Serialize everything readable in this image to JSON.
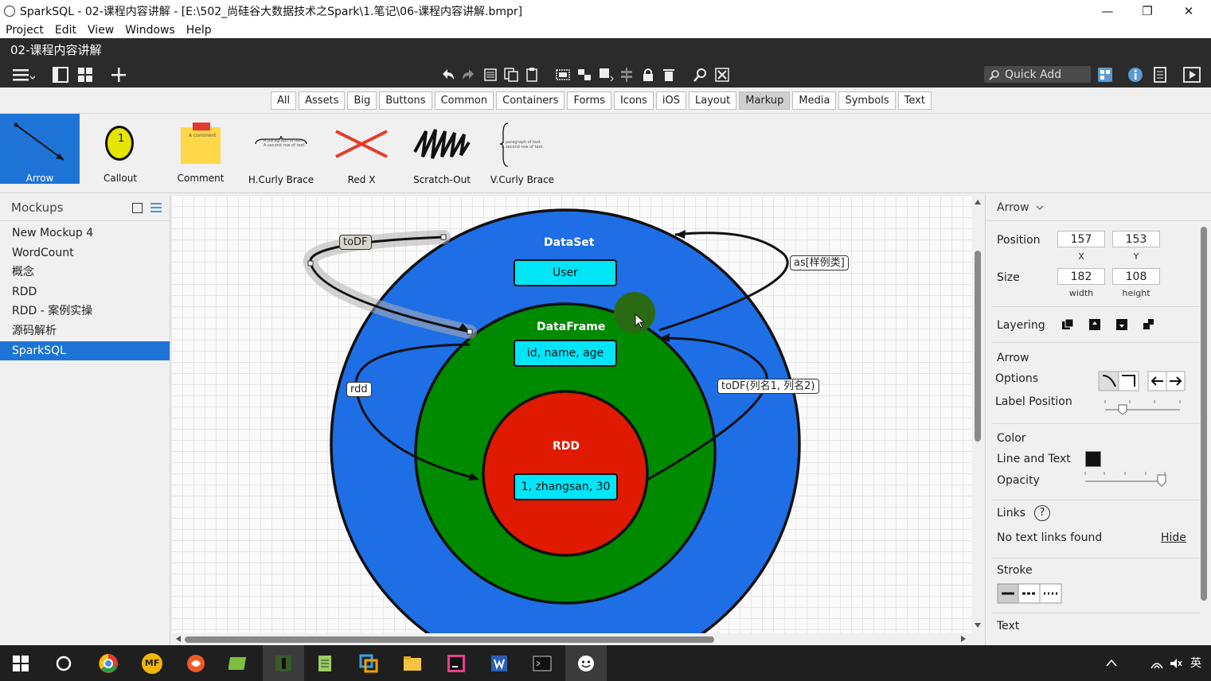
{
  "window": {
    "title": "SparkSQL - 02-课程内容讲解 - [E:\\502_尚硅谷大数据技术之Spark\\1.笔记\\06-课程内容讲解.bmpr]",
    "minimize": "—",
    "maximize": "❐",
    "close": "✕"
  },
  "menu": [
    "Project",
    "Edit",
    "View",
    "Windows",
    "Help"
  ],
  "document": {
    "name": "02-课程内容讲解"
  },
  "toolbar": {
    "quick_add_placeholder": "Quick Add"
  },
  "filters": {
    "tabs": [
      "All",
      "Assets",
      "Big",
      "Buttons",
      "Common",
      "Containers",
      "Forms",
      "Icons",
      "iOS",
      "Layout",
      "Markup",
      "Media",
      "Symbols",
      "Text"
    ],
    "active": "Markup"
  },
  "library": {
    "items": [
      "Arrow",
      "Callout",
      "Comment",
      "H.Curly Brace",
      "Red X",
      "Scratch-Out",
      "V.Curly Brace"
    ],
    "selected": "Arrow",
    "callout_number": "1",
    "comment_text": "A comment",
    "curly_text_1": "A paragraph of text.",
    "curly_text_2": "A second row of text."
  },
  "mockups": {
    "title": "Mockups",
    "items": [
      "New Mockup 4",
      "WordCount",
      "概念",
      "RDD",
      "RDD - 案例实操",
      "源码解析",
      "SparkSQL"
    ],
    "active": "SparkSQL"
  },
  "diagram": {
    "dataset_title": "DataSet",
    "dataset_box": "User",
    "dataframe_title": "DataFrame",
    "dataframe_box": "id, name, age",
    "rdd_title": "RDD",
    "rdd_box": "1, zhangsan, 30",
    "arrow_todf_top": "toDF",
    "arrow_as": "as[样例类]",
    "arrow_rdd": "rdd",
    "arrow_todf_cols": "toDF(列名1, 列名2)",
    "colors": {
      "dataset": "#1e6ee6",
      "dataframe": "#008a00",
      "rdd": "#e01a00",
      "box": "#00e5f8"
    }
  },
  "properties": {
    "header": "Arrow",
    "position_label": "Position",
    "x": "157",
    "y": "153",
    "x_label": "X",
    "y_label": "Y",
    "size_label": "Size",
    "width": "182",
    "height": "108",
    "width_label": "width",
    "height_label": "height",
    "layering_label": "Layering",
    "arrow_label": "Arrow",
    "options_label": "Options",
    "label_position_label": "Label Position",
    "color_label": "Color",
    "line_text_label": "Line and Text",
    "opacity_label": "Opacity",
    "links_label": "Links",
    "links_help": "?",
    "no_links": "No text links found",
    "hide_link": "Hide",
    "stroke_label": "Stroke",
    "text_label": "Text"
  },
  "taskbar": {
    "icons": [
      "windows-start-icon",
      "cortana-icon",
      "chrome-icon",
      "mf-icon",
      "browser-icon",
      "app-icon",
      "scene-icon",
      "notepad-icon",
      "vmware-icon",
      "explorer-icon",
      "intellij-icon",
      "word-icon",
      "terminal-icon",
      "balsamiq-icon"
    ],
    "mf_text": "MF",
    "ime": "英"
  }
}
